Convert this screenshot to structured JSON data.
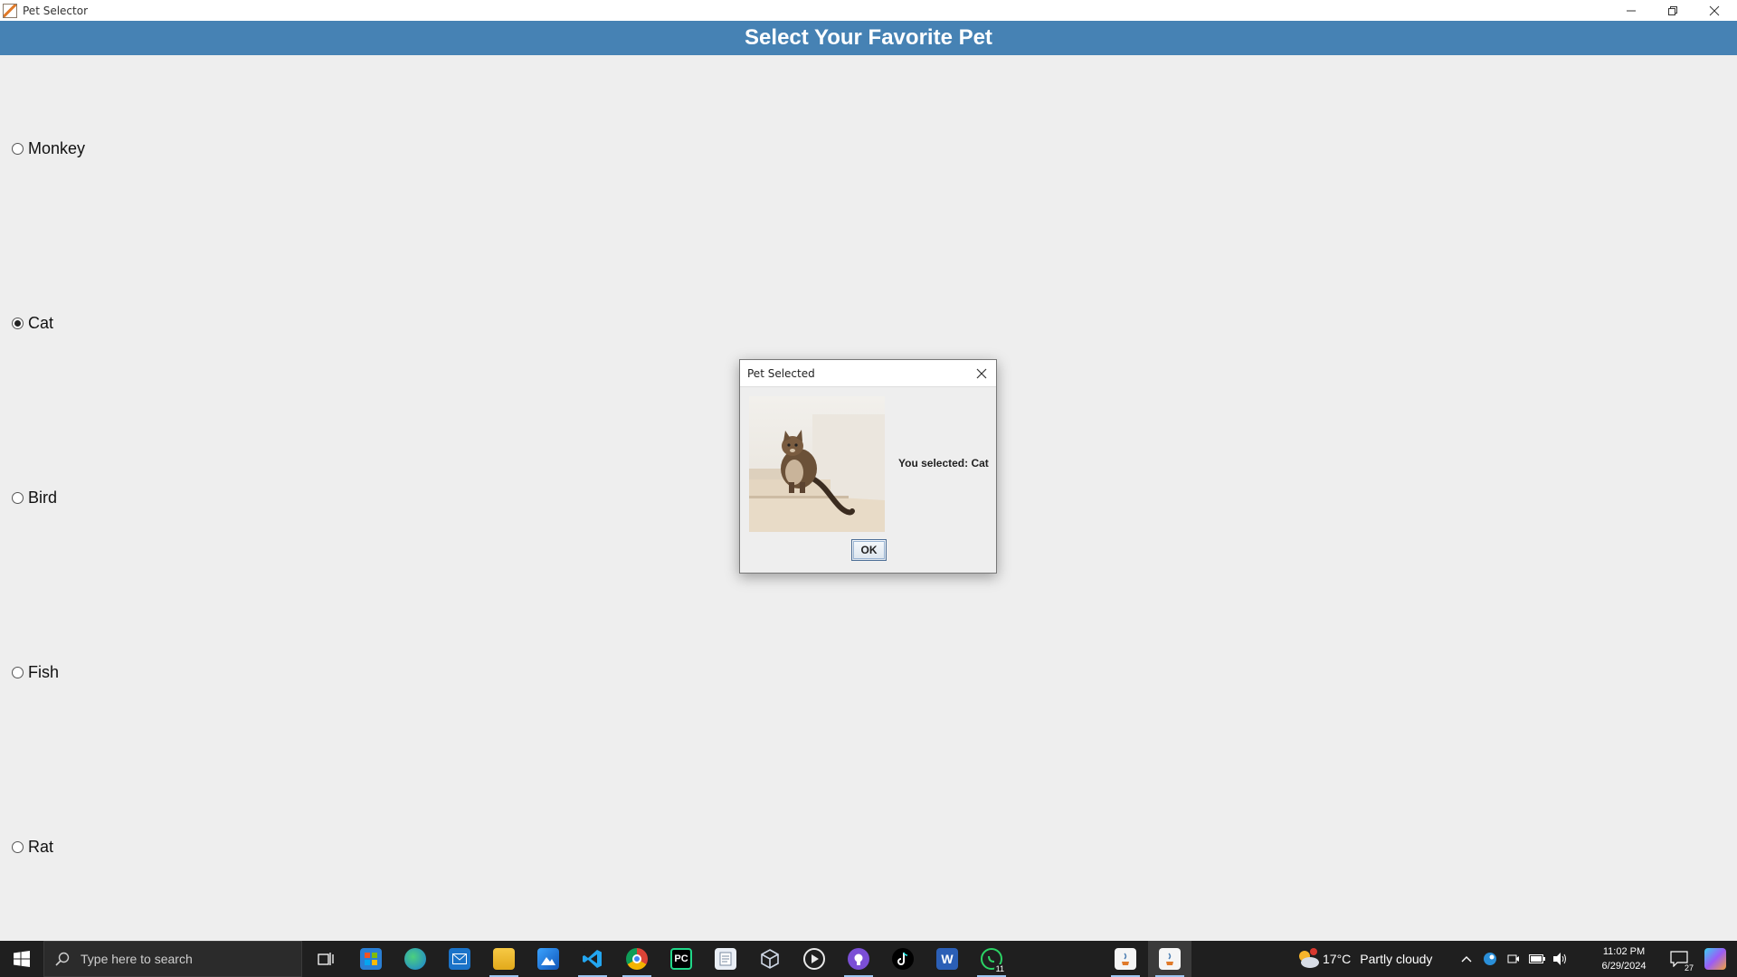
{
  "window": {
    "title": "Pet Selector"
  },
  "header": {
    "title": "Select Your Favorite Pet",
    "background": "#4682b4"
  },
  "pets": [
    {
      "label": "Monkey",
      "selected": false
    },
    {
      "label": "Cat",
      "selected": true
    },
    {
      "label": "Bird",
      "selected": false
    },
    {
      "label": "Fish",
      "selected": false
    },
    {
      "label": "Rat",
      "selected": false
    }
  ],
  "dialog": {
    "title": "Pet Selected",
    "message": "You selected: Cat",
    "ok_label": "OK",
    "image": "cat-photo"
  },
  "taskbar": {
    "search_placeholder": "Type here to search",
    "apps": [
      {
        "name": "task-view-icon"
      },
      {
        "name": "microsoft-store-icon"
      },
      {
        "name": "edge-icon"
      },
      {
        "name": "mail-icon"
      },
      {
        "name": "file-explorer-icon"
      },
      {
        "name": "photos-icon"
      },
      {
        "name": "vscode-icon"
      },
      {
        "name": "chrome-icon"
      },
      {
        "name": "pycharm-icon",
        "text": "PC"
      },
      {
        "name": "notepad-icon"
      },
      {
        "name": "virtualbox-icon"
      },
      {
        "name": "media-player-icon"
      },
      {
        "name": "github-desktop-icon"
      },
      {
        "name": "tiktok-icon"
      },
      {
        "name": "word-icon",
        "text": "W"
      },
      {
        "name": "whatsapp-icon",
        "badge": "11"
      },
      {
        "name": "java-app-icon"
      },
      {
        "name": "java-app-icon"
      }
    ],
    "weather": {
      "temperature": "17°C",
      "condition": "Partly cloudy"
    },
    "clock": {
      "time": "11:02 PM",
      "date": "6/29/2024"
    },
    "notifications": {
      "count": "27"
    }
  }
}
